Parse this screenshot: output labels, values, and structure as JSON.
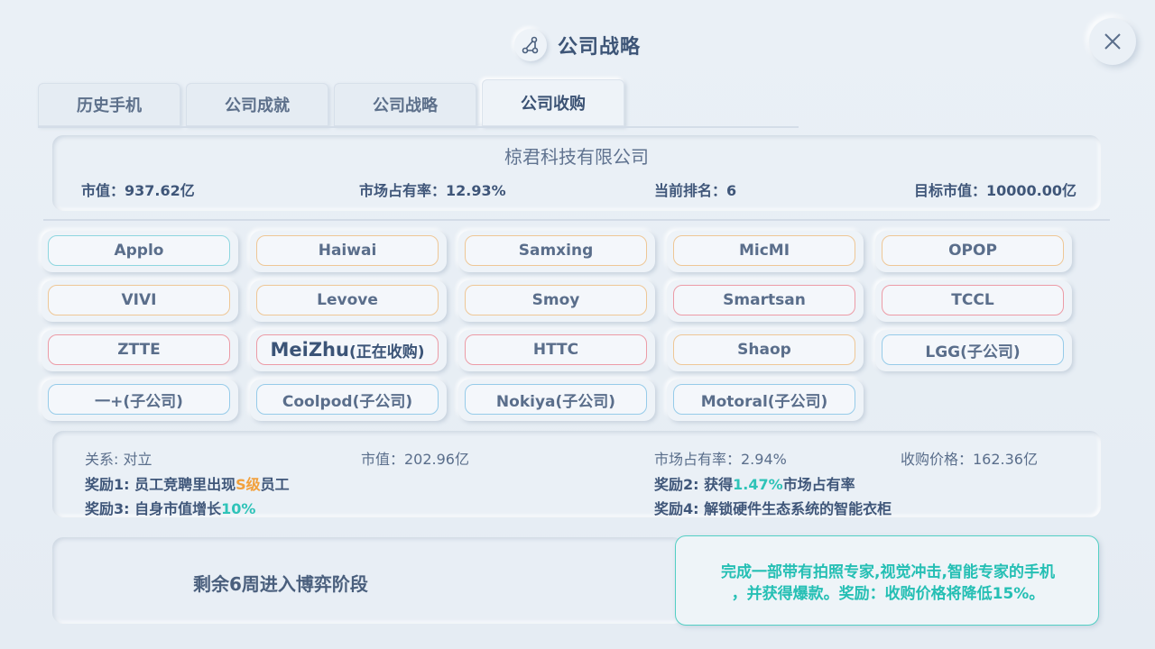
{
  "header": {
    "title": "公司战略",
    "icon": "strategy-icon"
  },
  "close": {
    "icon": "close-icon"
  },
  "tabs": [
    {
      "label": "历史手机",
      "active": false
    },
    {
      "label": "公司成就",
      "active": false
    },
    {
      "label": "公司战略",
      "active": false
    },
    {
      "label": "公司收购",
      "active": true
    }
  ],
  "company": {
    "name": "椋君科技有限公司",
    "market_value": "市值：937.62亿",
    "market_share": "市场占有率：12.93%",
    "rank": "当前排名：6",
    "target_value": "目标市值：10000.00亿"
  },
  "companies": [
    {
      "name": "Applo",
      "border": "cyan"
    },
    {
      "name": "Haiwai",
      "border": "orange"
    },
    {
      "name": "Samxing",
      "border": "orange"
    },
    {
      "name": "MicMI",
      "border": "orange"
    },
    {
      "name": "OPOP",
      "border": "orange"
    },
    {
      "name": "VIVI",
      "border": "orange"
    },
    {
      "name": "Levove",
      "border": "orange"
    },
    {
      "name": "Smoy",
      "border": "orange"
    },
    {
      "name": "Smartsan",
      "border": "red"
    },
    {
      "name": "TCCL",
      "border": "red"
    },
    {
      "name": "ZTTE",
      "border": "red"
    },
    {
      "name": "MeiZhu",
      "suffix": "(正在收购)",
      "border": "red",
      "acquiring": true
    },
    {
      "name": "HTTC",
      "border": "red"
    },
    {
      "name": "Shaop",
      "border": "orange"
    },
    {
      "name": "LGG(子公司)",
      "border": "blue"
    },
    {
      "name": "一+(子公司)",
      "border": "blue"
    },
    {
      "name": "Coolpod(子公司)",
      "border": "blue"
    },
    {
      "name": "Nokiya(子公司)",
      "border": "blue"
    },
    {
      "name": "Motoral(子公司)",
      "border": "blue"
    }
  ],
  "detail": {
    "relation": "关系: 对立",
    "market_value": "市值：202.96亿",
    "market_share": "市场占有率：2.94%",
    "price": "收购价格：162.36亿",
    "reward1": {
      "prefix": "奖励1: 员工竞聘里出现",
      "highlight": "S级",
      "suffix": "员工"
    },
    "reward2": {
      "prefix": "奖励2: 获得",
      "highlight": "1.47%",
      "suffix": "市场占有率"
    },
    "reward3": {
      "prefix": "奖励3: 自身市值增长",
      "highlight": "10%"
    },
    "reward4": "奖励4: 解锁硬件生态系统的智能衣柜"
  },
  "phase": {
    "text": "剩余6周进入博弈阶段"
  },
  "task": {
    "line1": "完成一部带有拍照专家,视觉冲击,智能专家的手机",
    "line2": "，并获得爆款。奖励：收购价格将降低15%。"
  },
  "colors": {
    "accent_cyan": "#2fc3b8",
    "accent_orange": "#f2a03b",
    "title": "#3d5577"
  }
}
